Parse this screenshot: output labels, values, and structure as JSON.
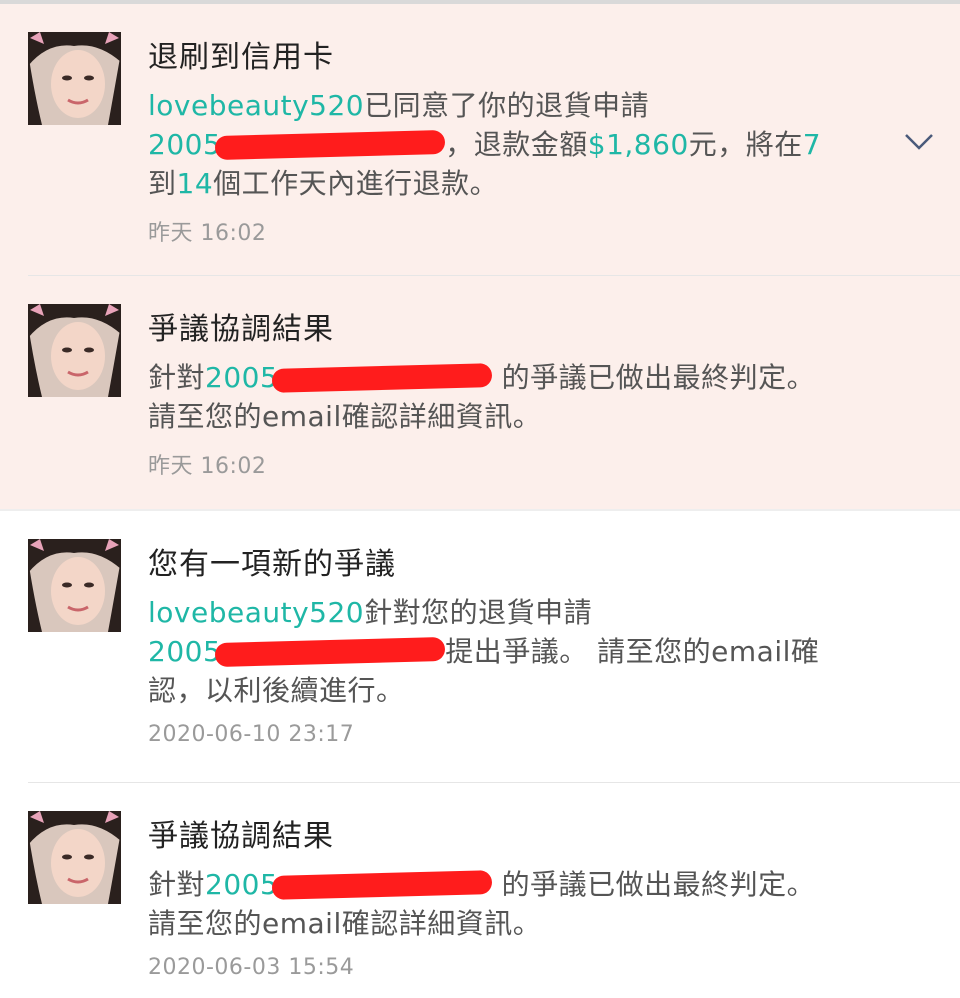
{
  "notifications": [
    {
      "title": "退刷到信用卡",
      "user": "lovebeauty520",
      "text_a": "已同意了你的退貨申請",
      "order_prefix": "2005",
      "text_b": "，退款金額",
      "amount": "$1,860",
      "text_c": "元，將在",
      "days_from": "7",
      "text_d": "到",
      "days_to": "14",
      "text_e": "個工作天內進行退款。",
      "time": "昨天 16:02",
      "unread": true,
      "icon": "chevron-down-icon"
    },
    {
      "title": "爭議協調結果",
      "text_a": "針對",
      "order_prefix": "2005",
      "text_b": " 的爭議已做出最終判定。請至您的email確認詳細資訊。",
      "time": "昨天 16:02",
      "unread": true
    },
    {
      "title": "您有一項新的爭議",
      "user": "lovebeauty520",
      "text_a": "針對您的退貨申請",
      "order_prefix": "2005",
      "text_b": "提出爭議。 請至您的email確認，以利後續進行。",
      "time": "2020-06-10 23:17",
      "unread": false
    },
    {
      "title": "爭議協調結果",
      "text_a": "針對",
      "order_prefix": "2005",
      "text_b": " 的爭議已做出最終判定。請至您的email確認詳細資訊。",
      "time": "2020-06-03 15:54",
      "unread": false
    }
  ],
  "colors": {
    "accent": "#1fb7a6",
    "unread_bg": "#fcefeb",
    "redaction": "#ff1c1c"
  }
}
